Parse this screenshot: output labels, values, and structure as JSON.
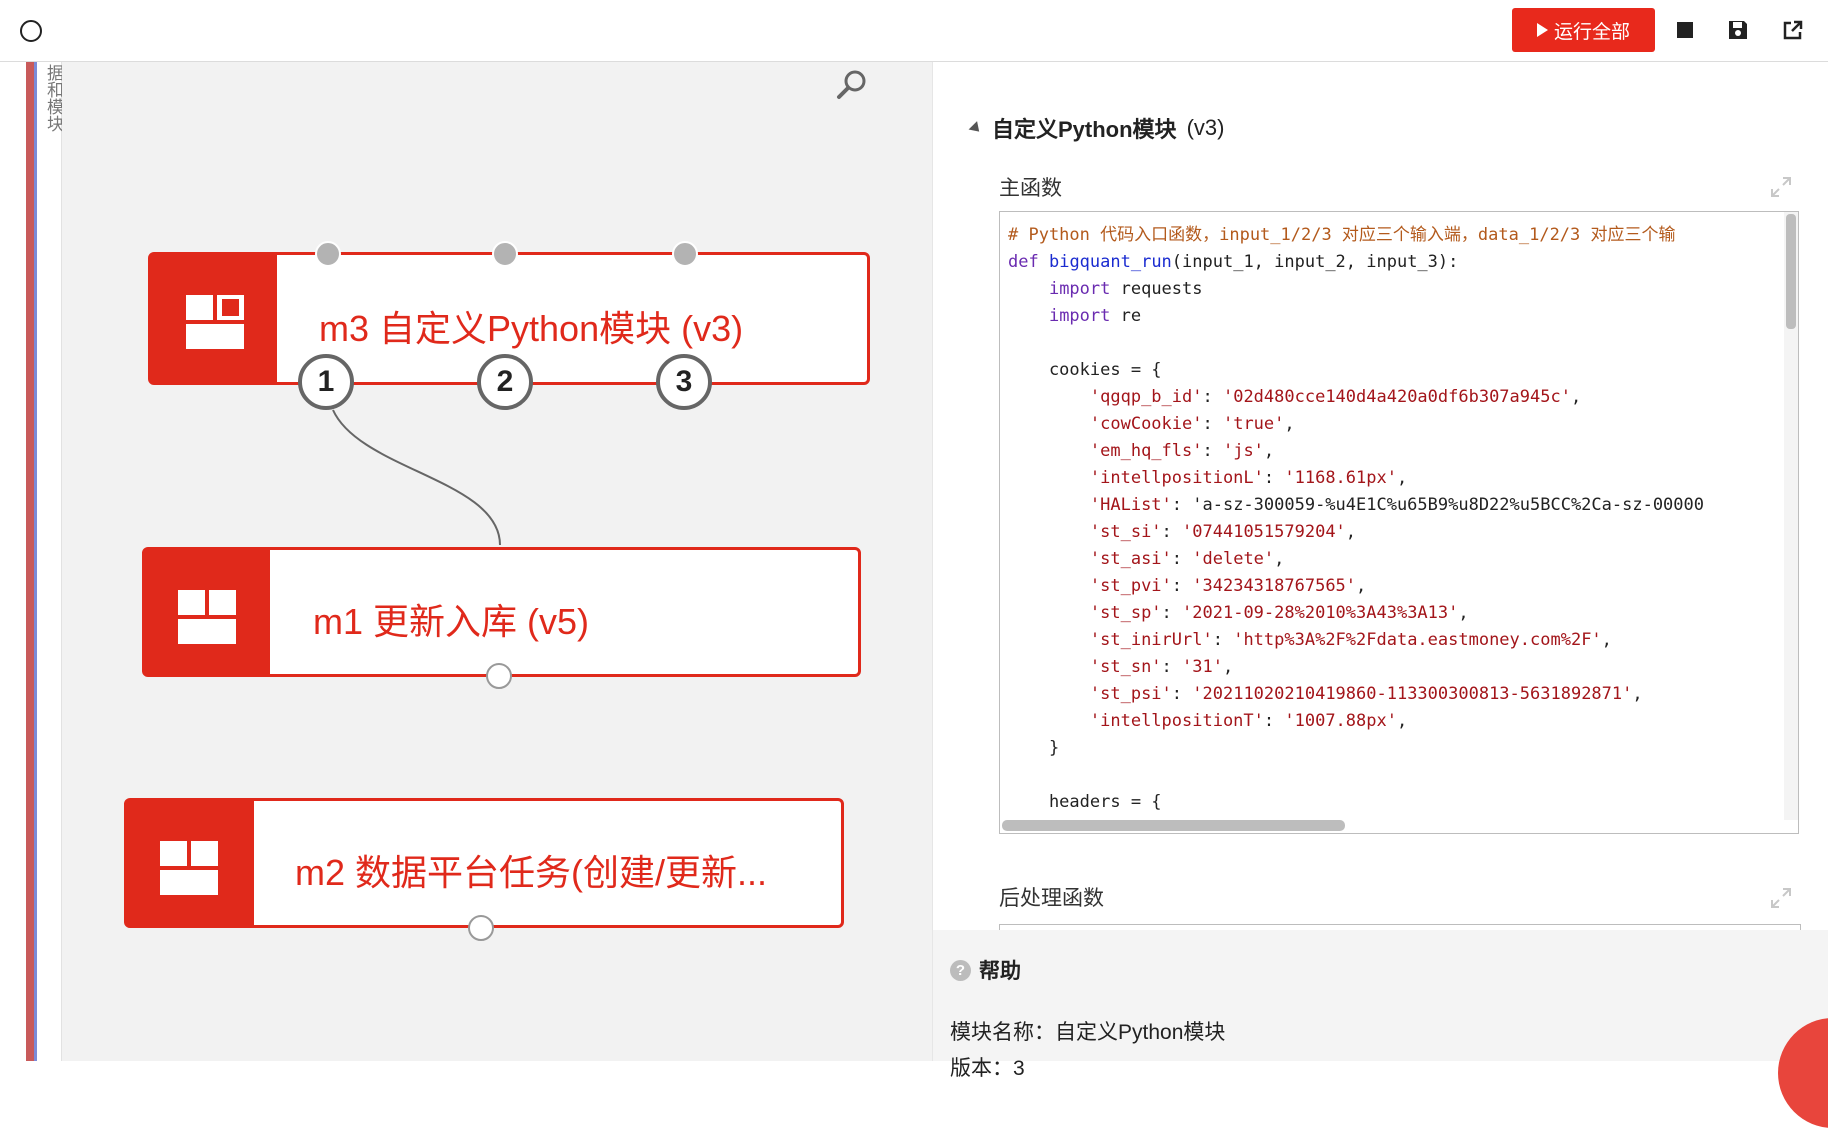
{
  "toolbar": {
    "run_all_label": "运行全部",
    "stop_icon": "stop-icon",
    "save_icon": "save-icon",
    "open_external_icon": "external-link-icon"
  },
  "sidebar": {
    "tab_label": "据和模块"
  },
  "canvas": {
    "modules": [
      {
        "id": "m3",
        "label": "m3 自定义Python模块 (v3)",
        "outputs": [
          "1",
          "2",
          "3"
        ]
      },
      {
        "id": "m1",
        "label": "m1 更新入库 (v5)"
      },
      {
        "id": "m2",
        "label": "m2 数据平台任务(创建/更新..."
      }
    ],
    "accent_color": "#e0291b"
  },
  "panel": {
    "section_title": "自定义Python模块",
    "section_version": "(v3)",
    "main_func_label": "主函数",
    "post_func_label": "后处理函数",
    "code_lines": [
      "# Python 代码入口函数，input_1/2/3 对应三个输入端，data_1/2/3 对应三个输",
      "def bigquant_run(input_1, input_2, input_3):",
      "    import requests",
      "    import re",
      "",
      "    cookies = {",
      "        'qgqp_b_id': '02d480cce140d4a420a0df6b307a945c',",
      "        'cowCookie': 'true',",
      "        'em_hq_fls': 'js',",
      "        'intellpositionL': '1168.61px',",
      "        'HAList': 'a-sz-300059-%u4E1C%u65B9%u8D22%u5BCC%2Ca-sz-00000",
      "        'st_si': '07441051579204',",
      "        'st_asi': 'delete',",
      "        'st_pvi': '34234318767565',",
      "        'st_sp': '2021-09-28%2010%3A43%3A13',",
      "        'st_inirUrl': 'http%3A%2F%2Fdata.eastmoney.com%2F',",
      "        'st_sn': '31',",
      "        'st_psi': '20211020210419860-113300300813-5631892871',",
      "        'intellpositionT': '1007.88px',",
      "    }",
      "",
      "    headers = {"
    ]
  },
  "help": {
    "title": "帮助",
    "module_name_line": "模块名称：自定义Python模块",
    "version_line": "版本：3"
  }
}
